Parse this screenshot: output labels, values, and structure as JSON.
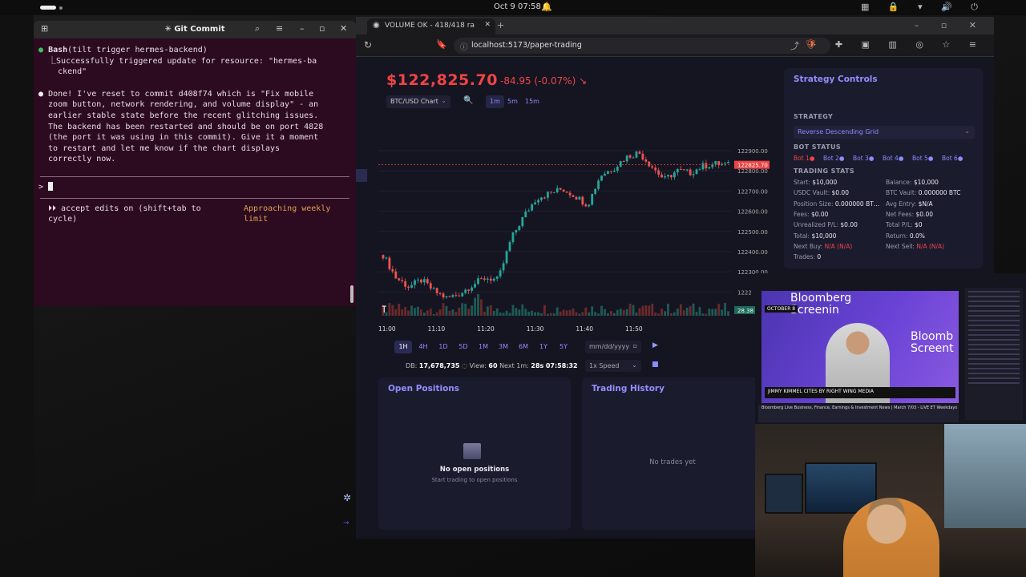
{
  "topbar": {
    "clock": "Oct 9  07:58",
    "bell": "🔔",
    "tray": "▦ 🔒 ▾ 🔊 ⏻"
  },
  "terminal": {
    "title": "✳ Git Commit",
    "lines": {
      "l1_bullet": "●",
      "l1_cmd": "Bash",
      "l1_rest": "(tilt trigger hermes-backend)",
      "l2": "  ⎿Successfully triggered update for resource: \"hermes-ba",
      "l3": "    ckend\"",
      "l4_bullet": "●",
      "l4": "Done! I've reset to commit d408f74 which is \"Fix mobile",
      "l5": "  zoom button, network rendering, and volume display\" - an",
      "l6": "  earlier stable state before the recent glitching issues.",
      "l7": "  The backend has been restarted and should be on port 4828",
      "l8": "  (the port it was using in this commit). Give it a moment",
      "l9": "  to restart and let me know if the chart displays",
      "l10": "  correctly now.",
      "prompt": "> ",
      "mode1": "  ⏵⏵ accept edits on (shift+tab to",
      "mode2": "  cycle)",
      "limit1": "Approaching weekly",
      "limit2": "limit"
    }
  },
  "browser": {
    "tab_title": "VOLUME OK - 418/418 ra",
    "url": "localhost:5173/paper-trading"
  },
  "trading": {
    "price": "$122,825.70",
    "change": "-84.95 (-0.07%) ↘",
    "chart_select": "BTC/USD Chart",
    "timeframes": [
      "1m",
      "5m",
      "15m"
    ],
    "ranges": [
      "1H",
      "4H",
      "1D",
      "5D",
      "1M",
      "3M",
      "6M",
      "1Y",
      "5Y"
    ],
    "date_placeholder": "mm/dd/yyyy",
    "speed": "1x Speed",
    "db_label": "DB:",
    "db_value": "17,678,735",
    "view_label": "View:",
    "view_value": "60",
    "next_label": "Next 1m:",
    "next_value": "28s",
    "time": "07:58:32"
  },
  "strategy": {
    "title": "Strategy Controls",
    "strategy_label": "STRATEGY",
    "strategy_value": "Reverse Descending Grid",
    "bot_status_label": "BOT STATUS",
    "bots": [
      "Bot 1●",
      "Bot 2●",
      "Bot 3●",
      "Bot 4●",
      "Bot 5●",
      "Bot 6●"
    ],
    "trading_stats_label": "TRADING STATS",
    "stats_left": [
      {
        "k": "Start:",
        "v": "$10,000"
      },
      {
        "k": "USDC Vault:",
        "v": "$0.00"
      },
      {
        "k": "Position Size:",
        "v": "0.000000 BT…"
      },
      {
        "k": "Fees:",
        "v": "$0.00"
      },
      {
        "k": "Unrealized P/L:",
        "v": "$0.00"
      },
      {
        "k": "Total:",
        "v": "$10,000"
      },
      {
        "k": "Next Buy:",
        "v": "N/A (N/A)"
      },
      {
        "k": "Trades:",
        "v": "0"
      }
    ],
    "stats_right": [
      {
        "k": "Balance:",
        "v": "$10,000"
      },
      {
        "k": "BTC Vault:",
        "v": "0.000000 BTC"
      },
      {
        "k": "Avg Entry:",
        "v": "$N/A"
      },
      {
        "k": "Net Fees:",
        "v": "$0.00"
      },
      {
        "k": "Total P/L:",
        "v": "$0"
      },
      {
        "k": "Return:",
        "v": "0.0%"
      },
      {
        "k": "Next Sell:",
        "v": "N/A (N/A)"
      }
    ]
  },
  "positions": {
    "title": "Open Positions",
    "empty_title": "No open positions",
    "empty_sub": "Start trading to open positions"
  },
  "history": {
    "title": "Trading History",
    "empty": "No trades yet"
  },
  "overlay": {
    "brand": "Bloomberg\nScreenin",
    "brand2": "Bloomb\nScreent",
    "date": "OCTOBER 8",
    "lower_third": "JIMMY KIMMEL CITES BY RIGHT WING MEDIA",
    "bottom": "Bloomberg Live Business, Finance, Earnings & Investment News | March 7/03 - LIVE ET Weekdays"
  },
  "chart_data": {
    "type": "candlestick",
    "x_ticks": [
      "11:00",
      "11:10",
      "11:20",
      "11:30",
      "11:40",
      "11:50"
    ],
    "y_ticks": [
      "122900.00",
      "122800.00",
      "122700.00",
      "122600.00",
      "122500.00",
      "122400.00",
      "122300.00",
      "1222"
    ],
    "ylim": [
      122170,
      122930
    ],
    "current_price_label": "122825.70",
    "current_price": 122825.7,
    "volume_label": "28.38",
    "close_path": [
      122430,
      122330,
      122290,
      122320,
      122270,
      122240,
      122260,
      122300,
      122330,
      122320,
      122500,
      122600,
      122680,
      122700,
      122720,
      122690,
      122650,
      122780,
      122810,
      122860,
      122880,
      122820,
      122760,
      122800,
      122790,
      122820,
      122830,
      122825
    ]
  }
}
